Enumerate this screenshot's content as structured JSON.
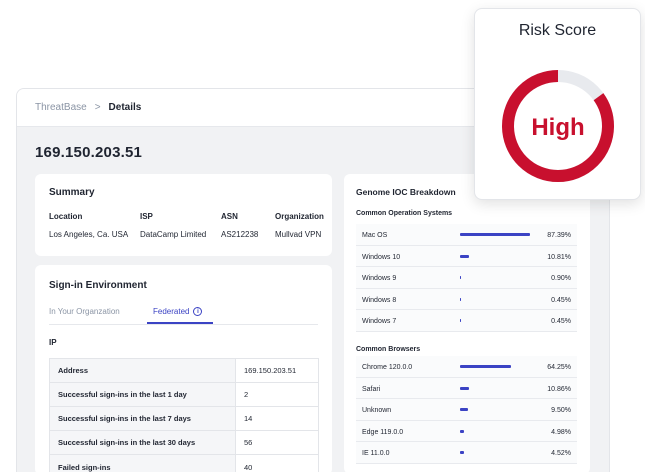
{
  "breadcrumb": {
    "root": "ThreatBase",
    "separator": ">",
    "current": "Details"
  },
  "page_title": "169.150.203.51",
  "summary": {
    "title": "Summary",
    "columns": [
      {
        "header": "Location",
        "value": "Los Angeles, Ca. USA"
      },
      {
        "header": "ISP",
        "value": "DataCamp Limited"
      },
      {
        "header": "ASN",
        "value": "AS212238"
      },
      {
        "header": "Organization",
        "value": "Mullvad VPN"
      }
    ]
  },
  "signin": {
    "title": "Sign-in Environment",
    "tabs": {
      "org": "In Your Organzation",
      "federated": "Federated"
    },
    "info_glyph": "i",
    "ip_label": "IP",
    "rows": [
      {
        "key": "Address",
        "value": "169.150.203.51"
      },
      {
        "key": "Successful sign-ins in the last 1 day",
        "value": "2"
      },
      {
        "key": "Successful sign-ins in the last 7 days",
        "value": "14"
      },
      {
        "key": "Successful sign-ins in the last 30 days",
        "value": "56"
      },
      {
        "key": "Failed sign-ins",
        "value": "40"
      }
    ]
  },
  "genome": {
    "title": "Genome IOC Breakdown",
    "os_heading": "Common Operation Systems",
    "os": [
      {
        "name": "Mac OS",
        "pct": "87.39%",
        "frac": 0.8739
      },
      {
        "name": "Windows 10",
        "pct": "10.81%",
        "frac": 0.1081
      },
      {
        "name": "Windows 9",
        "pct": "0.90%",
        "frac": 0.009
      },
      {
        "name": "Windows 8",
        "pct": "0.45%",
        "frac": 0.0045
      },
      {
        "name": "Windows 7",
        "pct": "0.45%",
        "frac": 0.0045
      }
    ],
    "browser_heading": "Common Browsers",
    "browsers": [
      {
        "name": "Chrome 120.0.0",
        "pct": "64.25%",
        "frac": 0.6425
      },
      {
        "name": "Safari",
        "pct": "10.86%",
        "frac": 0.1086
      },
      {
        "name": "Unknown",
        "pct": "9.50%",
        "frac": 0.095
      },
      {
        "name": "Edge 119.0.0",
        "pct": "4.98%",
        "frac": 0.0498
      },
      {
        "name": "IE 11.0.0",
        "pct": "4.52%",
        "frac": 0.0452
      }
    ]
  },
  "risk": {
    "title": "Risk Score",
    "level": "High",
    "fill": 0.85,
    "color": "#c8102e",
    "track_color": "#e8eaee"
  },
  "colors": {
    "accent": "#3b43c4",
    "risk": "#c8102e"
  }
}
